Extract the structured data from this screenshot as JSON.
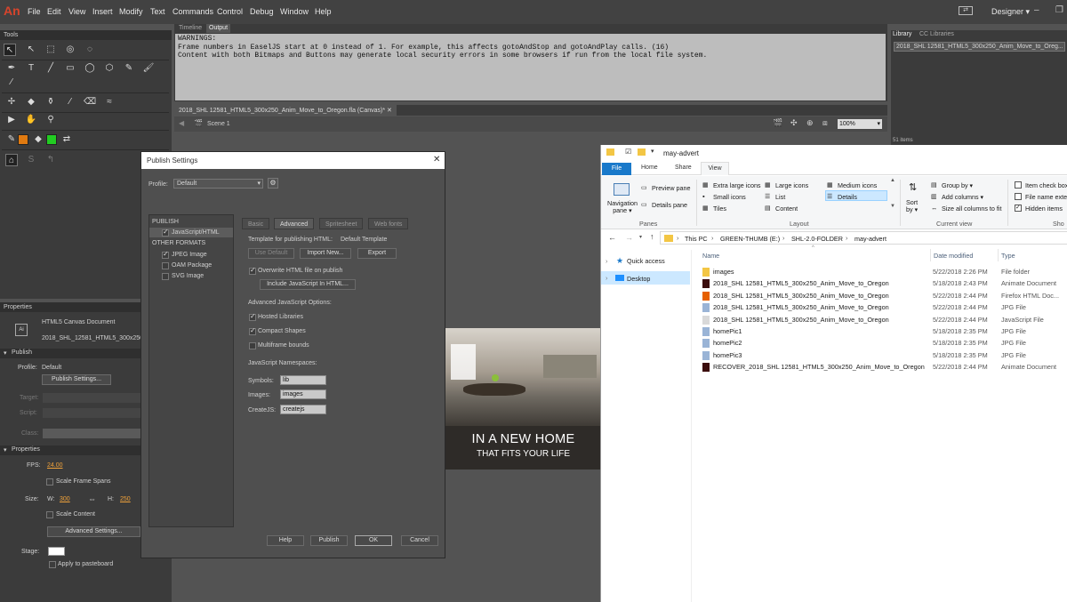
{
  "app": {
    "logo": "An",
    "workspace": "Designer ▾",
    "menu": [
      "File",
      "Edit",
      "View",
      "Insert",
      "Modify",
      "Text",
      "Commands",
      "Control",
      "Debug",
      "Window",
      "Help"
    ]
  },
  "tools": {
    "title": "Tools"
  },
  "output": {
    "tab_timeline": "Timeline",
    "tab_output": "Output",
    "lines": [
      "WARNINGS:",
      "Frame numbers in EaselJS start at 0 instead of 1. For example, this affects gotoAndStop and gotoAndPlay calls. (16)",
      "Content with both Bitmaps and Buttons may generate local security errors in some browsers if run from the local file system."
    ]
  },
  "document": {
    "tab": "2018_SHL 12581_HTML5_300x250_Anim_Move_to_Oregon.fla (Canvas)*",
    "scene": "Scene 1",
    "zoom": "100%"
  },
  "library": {
    "tab_library": "Library",
    "tab_cc": "CC Libraries",
    "selector": "2018_SHL 12581_HTML5_300x250_Anim_Move_to_Oreg...",
    "items_count": "51 items"
  },
  "properties": {
    "title": "Properties",
    "doc_type": "HTML5 Canvas Document",
    "doc_name": "2018_SHL_12581_HTML5_300x250_...",
    "publish_section": "Publish",
    "profile_label": "Profile:",
    "profile_value": "Default",
    "publish_settings_btn": "Publish Settings...",
    "target_label": "Target:",
    "script_label": "Script:",
    "class_label": "Class:",
    "props_section": "Properties",
    "fps_label": "FPS:",
    "fps_value": "24.00",
    "scale_frame_spans": "Scale Frame Spans",
    "size_label": "Size:",
    "w_label": "W:",
    "w_value": "300",
    "h_label": "H:",
    "h_value": "250",
    "scale_content": "Scale Content",
    "advanced_btn": "Advanced Settings...",
    "stage_label": "Stage:",
    "apply_pasteboard": "Apply to pasteboard"
  },
  "publish_dialog": {
    "title": "Publish Settings",
    "profile_label": "Profile:",
    "profile_value": "Default",
    "publish_header": "PUBLISH",
    "js_html": "JavaScript/HTML",
    "other_formats": "OTHER FORMATS",
    "formats": [
      "JPEG Image",
      "OAM Package",
      "SVG Image"
    ],
    "tabs": [
      "Basic",
      "Advanced",
      "Spritesheet",
      "Web fonts"
    ],
    "template_label": "Template for publishing HTML:",
    "template_value": "Default Template",
    "use_default": "Use Default",
    "import_new": "Import New...",
    "export": "Export",
    "overwrite": "Overwrite HTML file on publish",
    "include_js": "Include JavaScript In HTML...",
    "adv_js_options": "Advanced JavaScript Options:",
    "hosted_libraries": "Hosted Libraries",
    "compact_shapes": "Compact Shapes",
    "multiframe_bounds": "Multiframe bounds",
    "namespaces": "JavaScript Namespaces:",
    "symbols_label": "Symbols:",
    "symbols_value": "lib",
    "images_label": "Images:",
    "images_value": "images",
    "createjs_label": "CreateJS:",
    "createjs_value": "createjs",
    "help": "Help",
    "publish": "Publish",
    "ok": "OK",
    "cancel": "Cancel"
  },
  "ad": {
    "headline": "IN A NEW HOME",
    "subline": "THAT FITS YOUR LIFE"
  },
  "explorer": {
    "title": "may-advert",
    "tabs": [
      "File",
      "Home",
      "Share",
      "View"
    ],
    "ribbon": {
      "navigation_pane": "Navigation pane ▾",
      "preview_pane": "Preview pane",
      "details_pane": "Details pane",
      "panes": "Panes",
      "extra_large": "Extra large icons",
      "large": "Large icons",
      "medium": "Medium icons",
      "small": "Small icons",
      "list": "List",
      "details": "Details",
      "tiles": "Tiles",
      "content": "Content",
      "layout": "Layout",
      "sort_by": "Sort by ▾",
      "group_by": "Group by ▾",
      "add_columns": "Add columns ▾",
      "size_columns": "Size all columns to fit",
      "current_view": "Current view",
      "item_check": "Item check box",
      "file_name_ext": "File name exte",
      "hidden_items": "Hidden items",
      "show": "Sho"
    },
    "breadcrumb": [
      "This PC",
      "GREEN-THUMB (E:)",
      "SHL-2.0-FOLDER",
      "may-advert"
    ],
    "nav": {
      "quick_access": "Quick access",
      "desktop": "Desktop"
    },
    "columns": {
      "name": "Name",
      "date": "Date modified",
      "type": "Type"
    },
    "files": [
      {
        "name": "images",
        "date": "5/22/2018 2:26 PM",
        "type": "File folder",
        "icon": "folder-icon"
      },
      {
        "name": "2018_SHL 12581_HTML5_300x250_Anim_Move_to_Oregon",
        "date": "5/18/2018 2:43 PM",
        "type": "Animate Document",
        "icon": "animate-doc-icon"
      },
      {
        "name": "2018_SHL 12581_HTML5_300x250_Anim_Move_to_Oregon",
        "date": "5/22/2018 2:44 PM",
        "type": "Firefox HTML Doc...",
        "icon": "firefox-icon"
      },
      {
        "name": "2018_SHL 12581_HTML5_300x250_Anim_Move_to_Oregon",
        "date": "5/22/2018 2:44 PM",
        "type": "JPG File",
        "icon": "jpg-icon"
      },
      {
        "name": "2018_SHL 12581_HTML5_300x250_Anim_Move_to_Oregon",
        "date": "5/22/2018 2:44 PM",
        "type": "JavaScript File",
        "icon": "js-icon"
      },
      {
        "name": "homePic1",
        "date": "5/18/2018 2:35 PM",
        "type": "JPG File",
        "icon": "jpg-icon"
      },
      {
        "name": "homePic2",
        "date": "5/18/2018 2:35 PM",
        "type": "JPG File",
        "icon": "jpg-icon"
      },
      {
        "name": "homePic3",
        "date": "5/18/2018 2:35 PM",
        "type": "JPG File",
        "icon": "jpg-icon"
      },
      {
        "name": "RECOVER_2018_SHL 12581_HTML5_300x250_Anim_Move_to_Oregon",
        "date": "5/22/2018 2:44 PM",
        "type": "Animate Document",
        "icon": "animate-doc-icon"
      }
    ]
  }
}
